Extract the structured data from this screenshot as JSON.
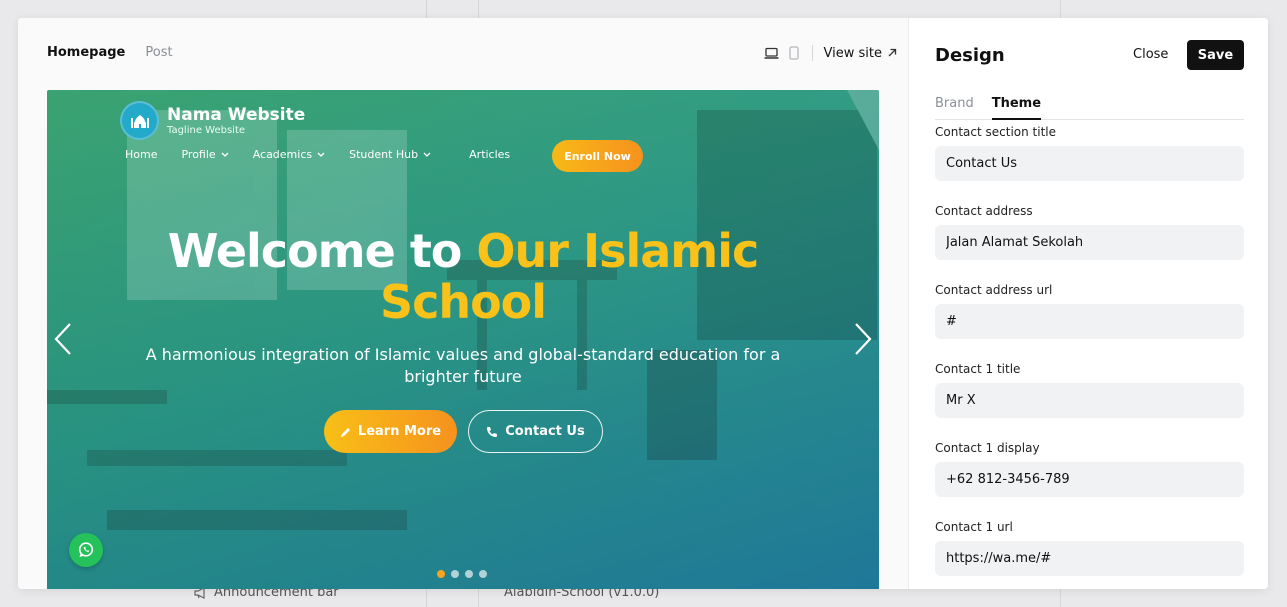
{
  "background": {
    "announcement_label": "Announcement bar",
    "version_label": "Alabidin-School (v1.0.0)"
  },
  "editor": {
    "tabs": [
      {
        "label": "Homepage",
        "active": true
      },
      {
        "label": "Post",
        "active": false
      }
    ],
    "view_site_label": "View site"
  },
  "preview": {
    "brand_name": "Nama Website",
    "brand_tagline": "Tagline Website",
    "nav": [
      {
        "label": "Home",
        "dropdown": false
      },
      {
        "label": "Profile",
        "dropdown": true
      },
      {
        "label": "Academics",
        "dropdown": true
      },
      {
        "label": "Student Hub",
        "dropdown": true
      },
      {
        "label": "Articles",
        "dropdown": false
      }
    ],
    "enroll_label": "Enroll Now",
    "hero_title_plain": "Welcome to",
    "hero_title_accent_1": "Our Islamic",
    "hero_title_accent_2": "School",
    "hero_subtitle": "A harmonious integration of Islamic values and global-standard education for a brighter future",
    "learn_more_label": "Learn More",
    "contact_us_label": "Contact Us",
    "slide_count": 4,
    "active_slide": 1,
    "accent_color": "#f9c21a",
    "overlay_colors": [
      "#2caa6e",
      "#1880aa"
    ]
  },
  "panel": {
    "title": "Design",
    "close_label": "Close",
    "save_label": "Save",
    "tabs": [
      {
        "label": "Brand",
        "active": false
      },
      {
        "label": "Theme",
        "active": true
      }
    ],
    "fields": [
      {
        "label": "Contact section title",
        "value": "Contact Us"
      },
      {
        "label": "Contact address",
        "value": "Jalan Alamat Sekolah"
      },
      {
        "label": "Contact address url",
        "value": "#"
      },
      {
        "label": "Contact 1 title",
        "value": "Mr X"
      },
      {
        "label": "Contact 1 display",
        "value": "+62 812-3456-789"
      },
      {
        "label": "Contact 1 url",
        "value": "https://wa.me/#"
      }
    ]
  }
}
